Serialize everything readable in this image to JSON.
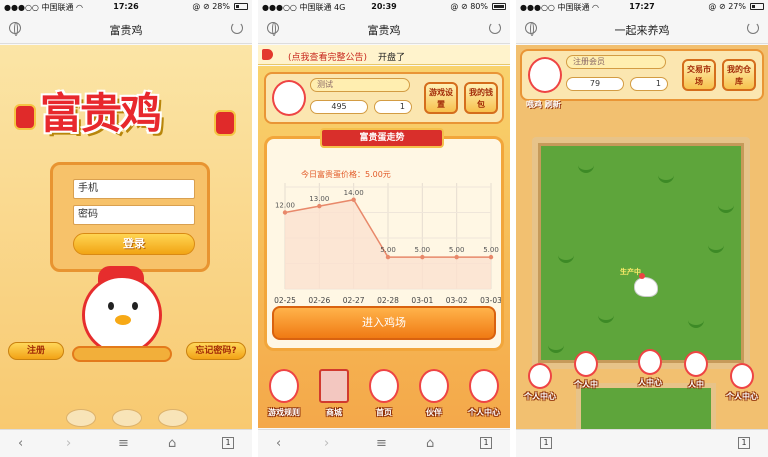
{
  "phone1": {
    "status": {
      "signal": "●●●○○ 中国联通 ◠",
      "time": "17:26",
      "battery": "@ ⊘ 28%",
      "battery_level": 0.28
    },
    "title": "富贵鸡",
    "logo_text": "富贵鸡",
    "login": {
      "phone_placeholder": "手机",
      "password_placeholder": "密码",
      "login_button": "登录"
    },
    "register_button": "注册",
    "forgot_button": "忘记密码?",
    "toolbar": {
      "tabs_count": "1"
    }
  },
  "phone2": {
    "status": {
      "signal": "●●●○○ 中国联通  4G",
      "time": "20:39",
      "battery": "@ ⊘ 80%",
      "battery_level": 0.8
    },
    "title": "富贵鸡",
    "notice": {
      "link": "(点我查看完整公告)",
      "text": "开盘了"
    },
    "hud": {
      "name": "测试",
      "coins": "495",
      "eggs": "1",
      "settings_button": "游戏设置",
      "wallet_button": "我的钱包"
    },
    "ribbon": "富贵蛋走势",
    "chart_data": {
      "type": "line",
      "title": "今日富贵蛋价格：5.00元",
      "categories": [
        "02-25",
        "02-26",
        "02-27",
        "02-28",
        "03-01",
        "03-02",
        "03-03"
      ],
      "values": [
        12.0,
        13.0,
        14.0,
        5.0,
        5.0,
        5.0,
        5.0
      ],
      "value_labels": [
        "12.00",
        "13.00",
        "14.00",
        "5.00",
        "5.00",
        "5.00",
        "5.00"
      ],
      "ylim": [
        0,
        16
      ],
      "grid": true,
      "line_color": "#e8886a",
      "fill_color": "#fbe1cf"
    },
    "enter_button": "进入鸡场",
    "dock": [
      {
        "label": "游戏规则"
      },
      {
        "label": "商城"
      },
      {
        "label": "首页"
      },
      {
        "label": "伙伴"
      },
      {
        "label": "个人中心"
      }
    ],
    "toolbar": {
      "tabs_count": "1"
    }
  },
  "phone3": {
    "status": {
      "signal": "●●●○○ 中国联通 ◠",
      "time": "17:27",
      "battery": "@ ⊘ 27%",
      "battery_level": 0.27
    },
    "title": "一起来养鸡",
    "hud": {
      "name": "注册会员",
      "coins": "79",
      "eggs": "1",
      "exchange_button": "交易市场",
      "warehouse_button": "我的仓库"
    },
    "sublinks": "喂鸡 刷新",
    "hen_label": "生产中",
    "characters": [
      {
        "label": "个人中心"
      },
      {
        "label": "个人中"
      },
      {
        "label": "人中心"
      },
      {
        "label": "人中"
      },
      {
        "label": "个人中心"
      }
    ],
    "toolbar": {
      "tabs_count": "1"
    }
  },
  "colors": {
    "accent_red": "#e8282d",
    "accent_orange": "#f07a14",
    "field_green": "#5ea53b"
  }
}
